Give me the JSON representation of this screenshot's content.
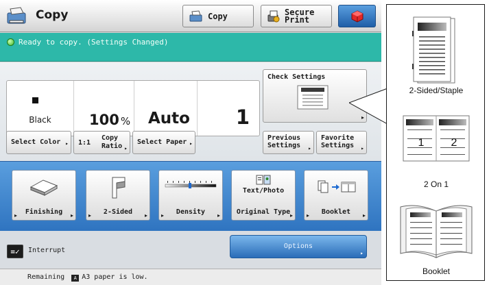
{
  "header": {
    "title": "Copy",
    "copy_button": "Copy",
    "secure_print_line1": "Secure",
    "secure_print_line2": "Print"
  },
  "status": {
    "message": "Ready to copy. (Settings Changed)"
  },
  "settings": {
    "color": "Black",
    "ratio": "100",
    "ratio_unit": "%",
    "paper": "Auto",
    "copies": "1",
    "select_color": "Select Color",
    "ratio_prefix": "1:1",
    "copy_ratio_line1": "Copy",
    "copy_ratio_line2": "Ratio",
    "select_paper": "Select Paper",
    "check_settings": "Check Settings",
    "previous_line1": "Previous",
    "previous_line2": "Settings",
    "favorite_line1": "Favorite",
    "favorite_line2": "Settings"
  },
  "functions": {
    "finishing": "Finishing",
    "two_sided": "2-Sided",
    "density": "Density",
    "text_photo": "Text/Photo",
    "original_type": "Original Type",
    "booklet": "Booklet"
  },
  "bottom": {
    "interrupt": "Interrupt",
    "options": "Options"
  },
  "message": {
    "prefix": "Remaining",
    "paper_icon": "A",
    "paper_size": "A3",
    "suffix": "paper is low."
  },
  "callout": {
    "item1": "2-Sided/Staple",
    "item2": "2 On 1",
    "item2_page1": "1",
    "item2_page2": "2",
    "item3": "Booklet"
  },
  "colors": {
    "status_bar": "#2db8a9",
    "function_panel": "#4a8fd1",
    "options_button": "#2a6cb8"
  }
}
